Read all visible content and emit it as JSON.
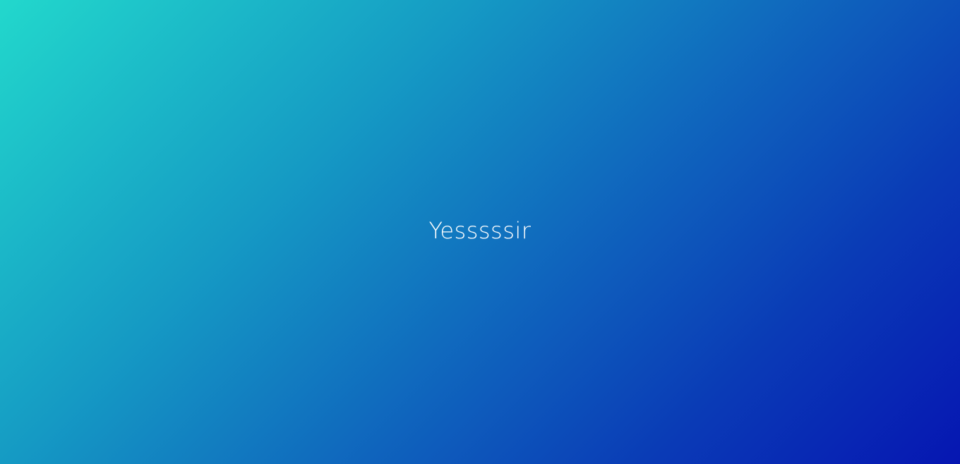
{
  "page": {
    "text": "Yesssssir"
  },
  "colors": {
    "gradient_start": "#22d8cc",
    "gradient_mid": "#0f64bd",
    "gradient_end": "#0616b2",
    "text": "#ffffff"
  }
}
